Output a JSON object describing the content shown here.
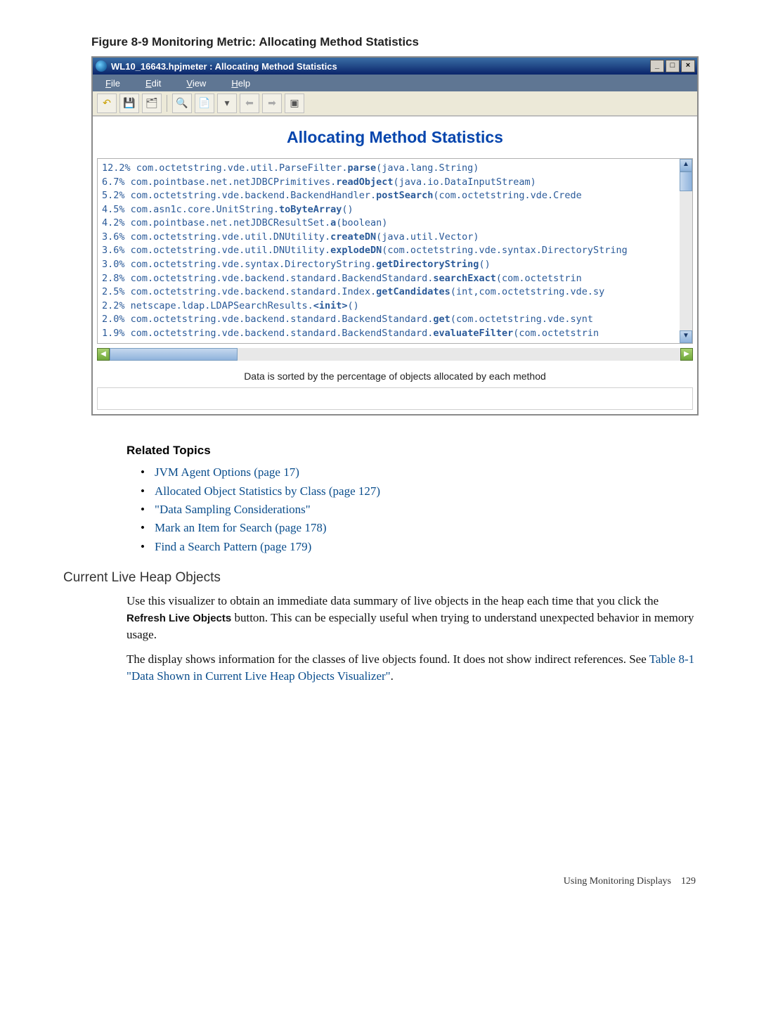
{
  "figure_caption": "Figure 8-9 Monitoring Metric: Allocating Method Statistics",
  "window": {
    "title": "WL10_16643.hpjmeter : Allocating Method Statistics",
    "menus": {
      "file": {
        "letter": "F",
        "rest": "ile"
      },
      "edit": {
        "letter": "E",
        "rest": "dit"
      },
      "view": {
        "letter": "V",
        "rest": "iew"
      },
      "help": {
        "letter": "H",
        "rest": "elp"
      }
    },
    "content_title": "Allocating Method Statistics",
    "rows": [
      {
        "pct": "12.2%",
        "pre": " com.octetstring.vde.util.ParseFilter.",
        "bold": "parse",
        "post": "(java.lang.String)"
      },
      {
        "pct": " 6.7%",
        "pre": " com.pointbase.net.netJDBCPrimitives.",
        "bold": "readObject",
        "post": "(java.io.DataInputStream)"
      },
      {
        "pct": " 5.2%",
        "pre": " com.octetstring.vde.backend.BackendHandler.",
        "bold": "postSearch",
        "post": "(com.octetstring.vde.Crede"
      },
      {
        "pct": " 4.5%",
        "pre": " com.asn1c.core.UnitString.",
        "bold": "toByteArray",
        "post": "()"
      },
      {
        "pct": " 4.2%",
        "pre": " com.pointbase.net.netJDBCResultSet.",
        "bold": "a",
        "post": "(boolean)"
      },
      {
        "pct": " 3.6%",
        "pre": " com.octetstring.vde.util.DNUtility.",
        "bold": "createDN",
        "post": "(java.util.Vector)"
      },
      {
        "pct": " 3.6%",
        "pre": " com.octetstring.vde.util.DNUtility.",
        "bold": "explodeDN",
        "post": "(com.octetstring.vde.syntax.DirectoryString"
      },
      {
        "pct": " 3.0%",
        "pre": " com.octetstring.vde.syntax.DirectoryString.",
        "bold": "getDirectoryString",
        "post": "()"
      },
      {
        "pct": " 2.8%",
        "pre": " com.octetstring.vde.backend.standard.BackendStandard.",
        "bold": "searchExact",
        "post": "(com.octetstrin"
      },
      {
        "pct": " 2.5%",
        "pre": " com.octetstring.vde.backend.standard.Index.",
        "bold": "getCandidates",
        "post": "(int,com.octetstring.vde.sy"
      },
      {
        "pct": " 2.2%",
        "pre": " netscape.ldap.LDAPSearchResults.",
        "bold": "<init>",
        "post": "()"
      },
      {
        "pct": " 2.0%",
        "pre": " com.octetstring.vde.backend.standard.BackendStandard.",
        "bold": "get",
        "post": "(com.octetstring.vde.synt"
      },
      {
        "pct": " 1.9%",
        "pre": " com.octetstring.vde.backend.standard.BackendStandard.",
        "bold": "evaluateFilter",
        "post": "(com.octetstrin"
      }
    ],
    "status_text": "Data is sorted by the percentage of objects allocated by each method"
  },
  "related": {
    "heading": "Related Topics",
    "items": [
      "JVM Agent Options (page 17)",
      "Allocated Object Statistics by Class (page 127)",
      "\"Data Sampling Considerations\"",
      "Mark an Item for Search (page 178)",
      "Find a Search Pattern (page 179)"
    ]
  },
  "section": {
    "heading": "Current Live Heap Objects",
    "para1_pre": "Use this visualizer to obtain an immediate data summary of live objects in the heap each time that you click the ",
    "para1_bold": "Refresh Live Objects",
    "para1_post": "  button. This can be especially useful when trying to understand unexpected behavior in memory usage.",
    "para2_pre": "The display shows information for the classes of live objects found. It does not show indirect references. See ",
    "para2_link": "Table 8-1 \"Data Shown in Current Live Heap Objects Visualizer\"",
    "para2_post": "."
  },
  "footer": {
    "text": "Using Monitoring Displays",
    "page": "129"
  }
}
